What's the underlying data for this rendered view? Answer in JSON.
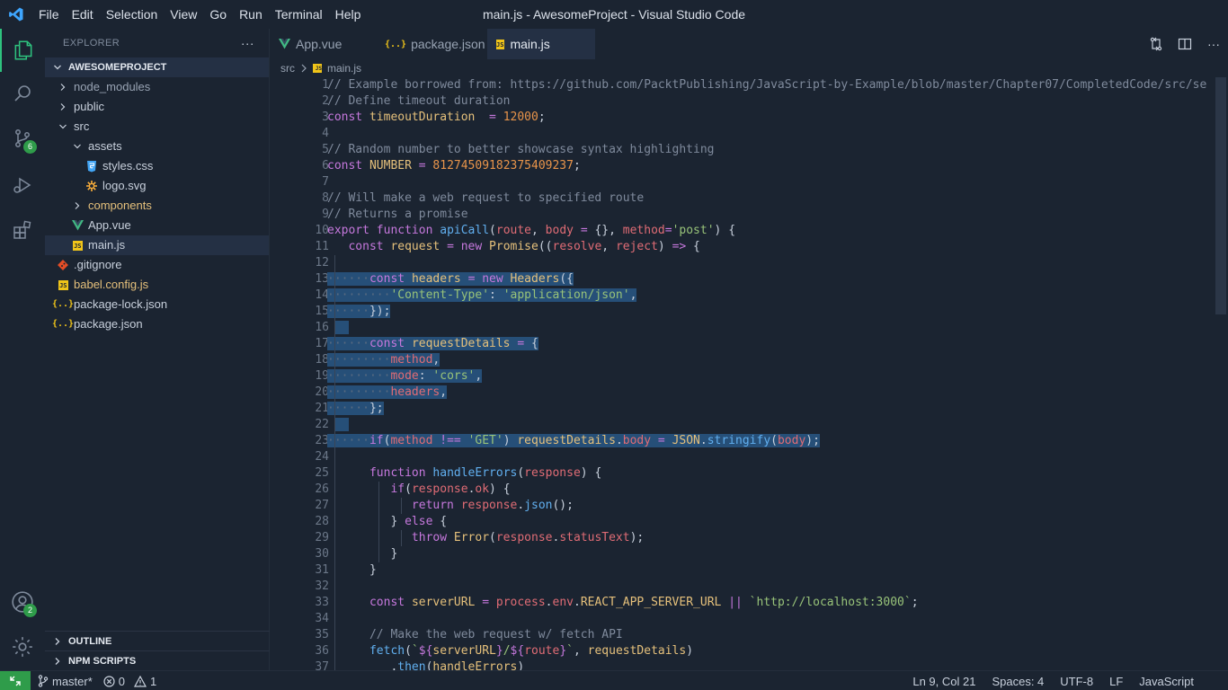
{
  "window": {
    "title": "main.js - AwesomeProject - Visual Studio Code"
  },
  "menu": [
    "File",
    "Edit",
    "Selection",
    "View",
    "Go",
    "Run",
    "Terminal",
    "Help"
  ],
  "activity": {
    "scm_badge": "6",
    "accounts_badge": "2"
  },
  "sidebar": {
    "title": "EXPLORER",
    "more": "···",
    "root": "AWESOMEPROJECT",
    "items": [
      {
        "label": "node_modules",
        "kind": "folder-closed",
        "depth": 0
      },
      {
        "label": "public",
        "kind": "folder-closed",
        "depth": 0
      },
      {
        "label": "src",
        "kind": "folder-open",
        "depth": 0
      },
      {
        "label": "assets",
        "kind": "folder-open",
        "depth": 1
      },
      {
        "label": "styles.css",
        "kind": "css",
        "depth": 2
      },
      {
        "label": "logo.svg",
        "kind": "svg",
        "depth": 2
      },
      {
        "label": "components",
        "kind": "folder-closed",
        "depth": 1,
        "color": "#e5c07b"
      },
      {
        "label": "App.vue",
        "kind": "vue",
        "depth": 1
      },
      {
        "label": "main.js",
        "kind": "js",
        "depth": 1,
        "selected": true
      },
      {
        "label": ".gitignore",
        "kind": "git",
        "depth": 0
      },
      {
        "label": "babel.config.js",
        "kind": "js",
        "depth": 0,
        "color": "#e5c07b"
      },
      {
        "label": "package-lock.json",
        "kind": "json",
        "depth": 0
      },
      {
        "label": "package.json",
        "kind": "json",
        "depth": 0
      }
    ],
    "outline": "OUTLINE",
    "npm_scripts": "NPM SCRIPTS"
  },
  "tabs": [
    {
      "label": "App.vue",
      "icon": "vue-icon",
      "active": false
    },
    {
      "label": "package.json",
      "icon": "json-icon",
      "active": false
    },
    {
      "label": "main.js",
      "icon": "js-icon",
      "active": true,
      "dirty": true
    }
  ],
  "breadcrumb": {
    "folder": "src",
    "file": "main.js"
  },
  "status": {
    "branch": "master*",
    "errors": "0",
    "warnings": "1",
    "position": "Ln 9, Col 21",
    "spaces": "Spaces: 4",
    "encoding": "UTF-8",
    "eol": "LF",
    "language": "JavaScript"
  },
  "editor": {
    "line_numbers": [
      "1",
      "2",
      "3",
      "4",
      "5",
      "6",
      "7",
      "8",
      "9",
      "10",
      "11",
      "12",
      "13",
      "14",
      "15",
      "16",
      "17",
      "18",
      "19",
      "20",
      "21",
      "22",
      "23",
      "24",
      "25",
      "26",
      "27",
      "28",
      "29",
      "30",
      "31",
      "32",
      "33",
      "34",
      "35",
      "36",
      "37"
    ],
    "lines": [
      [
        [
          "c",
          "// Example borrowed from: https://github.com/PacktPublishing/JavaScript-by-Example/blob/master/Chapter07/CompletedCode/src/se"
        ]
      ],
      [
        [
          "c",
          "// Define timeout duration"
        ]
      ],
      [
        [
          "k",
          "const "
        ],
        [
          "v",
          "timeoutDuration"
        ],
        [
          "",
          "  "
        ],
        [
          "o",
          "="
        ],
        [
          "",
          " "
        ],
        [
          "n",
          "12000"
        ],
        [
          "",
          ";"
        ]
      ],
      [],
      [
        [
          "c",
          "// Random number to better showcase syntax highlighting"
        ]
      ],
      [
        [
          "k",
          "const "
        ],
        [
          "v",
          "NUMBER"
        ],
        [
          "",
          " "
        ],
        [
          "o",
          "="
        ],
        [
          "",
          " "
        ],
        [
          "n",
          "81274509182375409237"
        ],
        [
          "",
          ";"
        ]
      ],
      [],
      [
        [
          "c",
          "// Will make a web request to specified route"
        ]
      ],
      [
        [
          "c",
          "// Returns a promise"
        ]
      ],
      [
        [
          "k",
          "export "
        ],
        [
          "k",
          "function "
        ],
        [
          "f",
          "apiCall"
        ],
        [
          "",
          "("
        ],
        [
          "p",
          "route"
        ],
        [
          "",
          ", "
        ],
        [
          "p",
          "body"
        ],
        [
          "",
          " "
        ],
        [
          "o",
          "="
        ],
        [
          "",
          " {}, "
        ],
        [
          "p",
          "method"
        ],
        [
          "o",
          "="
        ],
        [
          "s",
          "'post'"
        ],
        [
          "",
          ") {"
        ]
      ],
      [
        [
          "",
          "   "
        ],
        [
          "k",
          "const "
        ],
        [
          "v",
          "request"
        ],
        [
          "",
          " "
        ],
        [
          "o",
          "="
        ],
        [
          "",
          " "
        ],
        [
          "k",
          "new "
        ],
        [
          "y",
          "Promise"
        ],
        [
          "",
          "(("
        ],
        [
          "p",
          "resolve"
        ],
        [
          "",
          ", "
        ],
        [
          "p",
          "reject"
        ],
        [
          "",
          ") "
        ],
        [
          "o",
          "=>"
        ],
        [
          "",
          " {"
        ]
      ],
      [],
      [
        [
          "ws",
          "······"
        ],
        [
          "k",
          "const "
        ],
        [
          "v",
          "headers"
        ],
        [
          "",
          " "
        ],
        [
          "o",
          "="
        ],
        [
          "",
          " "
        ],
        [
          "k",
          "new "
        ],
        [
          "y",
          "Headers"
        ],
        [
          "",
          "({"
        ]
      ],
      [
        [
          "ws",
          "·········"
        ],
        [
          "s",
          "'Content-Type'"
        ],
        [
          "",
          ": "
        ],
        [
          "s",
          "'application/json'"
        ],
        [
          "",
          ","
        ]
      ],
      [
        [
          "ws",
          "······"
        ],
        [
          "",
          "});"
        ]
      ],
      [],
      [
        [
          "ws",
          "······"
        ],
        [
          "k",
          "const "
        ],
        [
          "v",
          "requestDetails"
        ],
        [
          "",
          " "
        ],
        [
          "o",
          "="
        ],
        [
          "",
          " {"
        ]
      ],
      [
        [
          "ws",
          "·········"
        ],
        [
          "p",
          "method"
        ],
        [
          "",
          ","
        ]
      ],
      [
        [
          "ws",
          "·········"
        ],
        [
          "p",
          "mode"
        ],
        [
          "",
          ": "
        ],
        [
          "s",
          "'cors'"
        ],
        [
          "",
          ","
        ]
      ],
      [
        [
          "ws",
          "·········"
        ],
        [
          "p",
          "headers"
        ],
        [
          "",
          ","
        ]
      ],
      [
        [
          "ws",
          "······"
        ],
        [
          "",
          "};"
        ]
      ],
      [],
      [
        [
          "ws",
          "······"
        ],
        [
          "k",
          "if"
        ],
        [
          "",
          "("
        ],
        [
          "p",
          "method"
        ],
        [
          "",
          " "
        ],
        [
          "o",
          "!=="
        ],
        [
          "",
          " "
        ],
        [
          "s",
          "'GET'"
        ],
        [
          "",
          ") "
        ],
        [
          "v",
          "requestDetails"
        ],
        [
          "",
          "."
        ],
        [
          "p",
          "body"
        ],
        [
          "",
          " "
        ],
        [
          "o",
          "="
        ],
        [
          "",
          " "
        ],
        [
          "y",
          "JSON"
        ],
        [
          "",
          "."
        ],
        [
          "f",
          "stringify"
        ],
        [
          "",
          "("
        ],
        [
          "p",
          "body"
        ],
        [
          "",
          ");"
        ]
      ],
      [],
      [
        [
          "",
          "      "
        ],
        [
          "k",
          "function "
        ],
        [
          "f",
          "handleErrors"
        ],
        [
          "",
          "("
        ],
        [
          "p",
          "response"
        ],
        [
          "",
          ") {"
        ]
      ],
      [
        [
          "",
          "         "
        ],
        [
          "k",
          "if"
        ],
        [
          "",
          "("
        ],
        [
          "p",
          "response"
        ],
        [
          "",
          "."
        ],
        [
          "p",
          "ok"
        ],
        [
          "",
          ") {"
        ]
      ],
      [
        [
          "",
          "            "
        ],
        [
          "k",
          "return "
        ],
        [
          "p",
          "response"
        ],
        [
          "",
          "."
        ],
        [
          "f",
          "json"
        ],
        [
          "",
          "();"
        ]
      ],
      [
        [
          "",
          "         "
        ],
        [
          "",
          "} "
        ],
        [
          "k",
          "else"
        ],
        [
          "",
          " {"
        ]
      ],
      [
        [
          "",
          "            "
        ],
        [
          "k",
          "throw "
        ],
        [
          "y",
          "Error"
        ],
        [
          "",
          "("
        ],
        [
          "p",
          "response"
        ],
        [
          "",
          "."
        ],
        [
          "p",
          "statusText"
        ],
        [
          "",
          ");"
        ]
      ],
      [
        [
          "",
          "         "
        ],
        [
          "",
          "}"
        ]
      ],
      [
        [
          "",
          "      "
        ],
        [
          "",
          "}"
        ]
      ],
      [],
      [
        [
          "",
          "      "
        ],
        [
          "k",
          "const "
        ],
        [
          "v",
          "serverURL"
        ],
        [
          "",
          " "
        ],
        [
          "o",
          "="
        ],
        [
          "",
          " "
        ],
        [
          "p",
          "process"
        ],
        [
          "",
          "."
        ],
        [
          "p",
          "env"
        ],
        [
          "",
          "."
        ],
        [
          "y",
          "REACT_APP_SERVER_URL"
        ],
        [
          "",
          " "
        ],
        [
          "o",
          "||"
        ],
        [
          "",
          " "
        ],
        [
          "s",
          "`http://localhost:3000`"
        ],
        [
          "",
          ";"
        ]
      ],
      [],
      [
        [
          "",
          "      "
        ],
        [
          "c",
          "// Make the web request w/ fetch API"
        ]
      ],
      [
        [
          "",
          "      "
        ],
        [
          "f",
          "fetch"
        ],
        [
          "",
          "("
        ],
        [
          "s",
          "`"
        ],
        [
          "k",
          "${"
        ],
        [
          "v",
          "serverURL"
        ],
        [
          "k",
          "}"
        ],
        [
          "s",
          "/"
        ],
        [
          "k",
          "${"
        ],
        [
          "p",
          "route"
        ],
        [
          "k",
          "}"
        ],
        [
          "s",
          "`"
        ],
        [
          "",
          ", "
        ],
        [
          "v",
          "requestDetails"
        ],
        [
          "",
          ")"
        ]
      ],
      [
        [
          "",
          "         "
        ],
        [
          "",
          "."
        ],
        [
          "f",
          "then"
        ],
        [
          "",
          "("
        ],
        [
          "v",
          "handleErrors"
        ],
        [
          "",
          ")"
        ]
      ]
    ]
  }
}
